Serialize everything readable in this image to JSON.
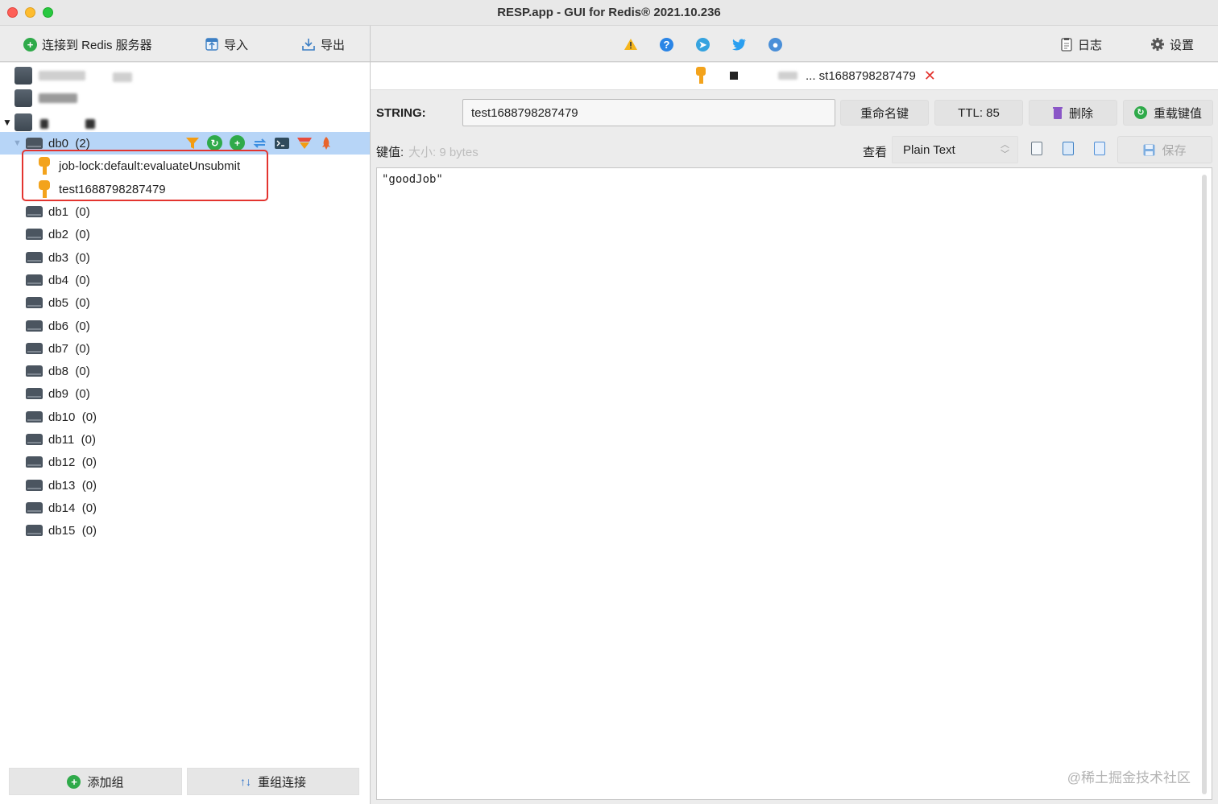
{
  "window": {
    "title": "RESP.app - GUI for Redis® 2021.10.236"
  },
  "toolbar": {
    "connect_label": "连接到 Redis 服务器",
    "import_label": "导入",
    "export_label": "导出",
    "log_label": "日志",
    "settings_label": "设置"
  },
  "tree": {
    "db0_label": "db0",
    "db0_count": "(2)",
    "keys": [
      "job-lock:default:evaluateUnsubmit",
      "test1688798287479"
    ],
    "dbs": [
      {
        "name": "db1",
        "count": "(0)"
      },
      {
        "name": "db2",
        "count": "(0)"
      },
      {
        "name": "db3",
        "count": "(0)"
      },
      {
        "name": "db4",
        "count": "(0)"
      },
      {
        "name": "db5",
        "count": "(0)"
      },
      {
        "name": "db6",
        "count": "(0)"
      },
      {
        "name": "db7",
        "count": "(0)"
      },
      {
        "name": "db8",
        "count": "(0)"
      },
      {
        "name": "db9",
        "count": "(0)"
      },
      {
        "name": "db10",
        "count": "(0)"
      },
      {
        "name": "db11",
        "count": "(0)"
      },
      {
        "name": "db12",
        "count": "(0)"
      },
      {
        "name": "db13",
        "count": "(0)"
      },
      {
        "name": "db14",
        "count": "(0)"
      },
      {
        "name": "db15",
        "count": "(0)"
      }
    ]
  },
  "left_bottom": {
    "add_group": "添加组",
    "regroup": "重组连接"
  },
  "tab": {
    "title": "... st1688798287479",
    "close": "✕"
  },
  "key_panel": {
    "type_label": "STRING:",
    "key_name": "test1688798287479",
    "rename": "重命名键",
    "ttl": "TTL:  85",
    "delete": "删除",
    "reload": "重载键值"
  },
  "value_panel": {
    "value_label": "键值:",
    "size_text": "大小:  9 bytes",
    "view_label": "查看",
    "view_mode": "Plain Text",
    "save": "保存",
    "content": "\"goodJob\""
  },
  "watermark": "@稀土掘金技术社区",
  "colors": {
    "selection": "#b7d5f7",
    "highlight_box": "#e3342f",
    "key_icon": "#f3a31c"
  }
}
